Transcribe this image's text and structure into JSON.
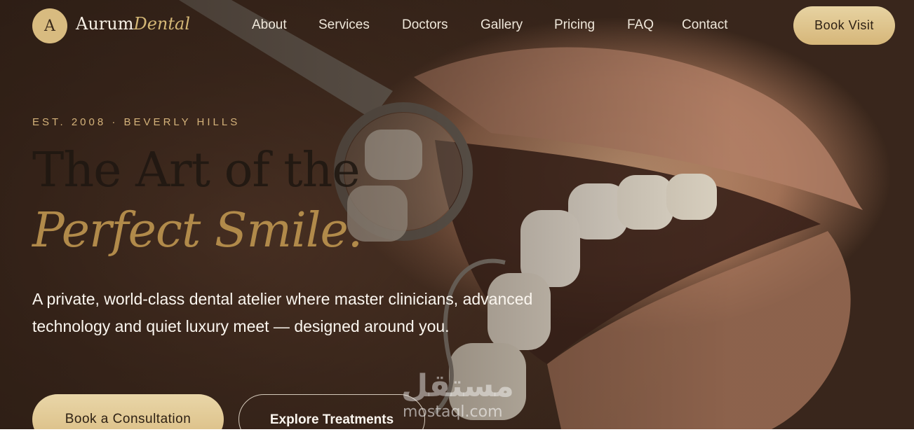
{
  "brand": {
    "mark": "A",
    "name": "Aurum",
    "name_accent": "Dental"
  },
  "nav": {
    "links": [
      "About",
      "Services",
      "Doctors",
      "Gallery",
      "Pricing",
      "FAQ",
      "Contact"
    ],
    "cta": "Book Visit"
  },
  "hero": {
    "eyebrow": "EST. 2008 · BEVERLY HILLS",
    "headline_line1": "The Art of the",
    "headline_line2": "Perfect Smile.",
    "lead": "A private, world-class dental atelier where master clinicians, advanced technology and quiet luxury meet — designed around you.",
    "primary_cta": "Book a Consultation",
    "secondary_cta": "Explore Treatments"
  },
  "watermark": {
    "arabic": "مستقل",
    "latin": "mostaql.com"
  },
  "colors": {
    "gold": "#d4b776",
    "gold_button": "#ddc38a",
    "text_light": "#f6efe4",
    "headline_dark": "#1f1711",
    "headline_gold": "#b18a4a"
  }
}
